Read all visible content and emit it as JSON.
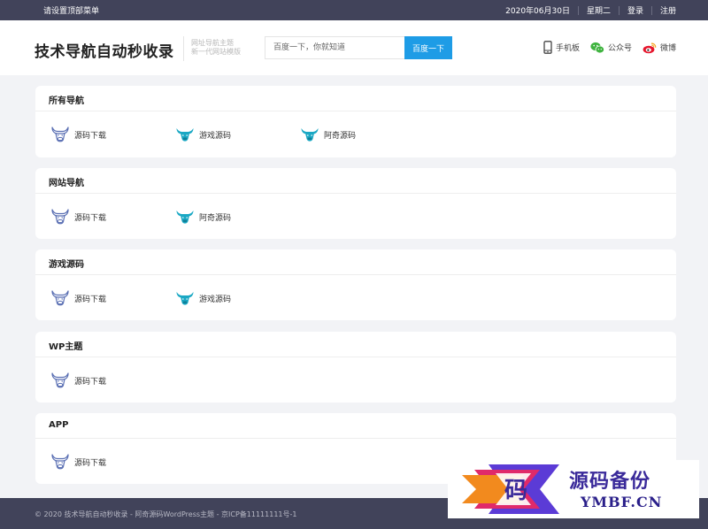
{
  "topbar": {
    "menu_text": "请设置顶部菜单",
    "date": "2020年06月30日",
    "weekday": "星期二",
    "login": "登录",
    "register": "注册"
  },
  "header": {
    "logo": "技术导航自动秒收录",
    "slogan_line1": "网址导航主题",
    "slogan_line2": "新一代网站模版",
    "search_placeholder": "百度一下，你就知道",
    "search_button": "百度一下",
    "links": {
      "mobile": "手机板",
      "wechat": "公众号",
      "weibo": "微博"
    }
  },
  "colors": {
    "accent": "#1e9ce6",
    "dark_bar": "#41435a",
    "bull_outline": "#5a6fb3",
    "bull_filled": "#1aa8c4"
  },
  "sections": [
    {
      "title": "所有导航",
      "sites": [
        {
          "label": "源码下载",
          "icon": "bull-outline-icon"
        },
        {
          "label": "游戏源码",
          "icon": "bull-filled-icon"
        },
        {
          "label": "阿奇源码",
          "icon": "bull-filled-icon"
        }
      ]
    },
    {
      "title": "网站导航",
      "sites": [
        {
          "label": "源码下载",
          "icon": "bull-outline-icon"
        },
        {
          "label": "阿奇源码",
          "icon": "bull-filled-icon"
        }
      ]
    },
    {
      "title": "游戏源码",
      "sites": [
        {
          "label": "源码下载",
          "icon": "bull-outline-icon"
        },
        {
          "label": "游戏源码",
          "icon": "bull-filled-icon"
        }
      ]
    },
    {
      "title": "WP主题",
      "sites": [
        {
          "label": "源码下载",
          "icon": "bull-outline-icon"
        }
      ]
    },
    {
      "title": "APP",
      "sites": [
        {
          "label": "源码下载",
          "icon": "bull-outline-icon"
        }
      ]
    }
  ],
  "footer": {
    "copyright": "© 2020 技术导航自动秒收录 - 阿奇源码WordPress主题 - 京ICP备11111111号-1"
  },
  "watermark": {
    "glyph": "码",
    "title": "源码备份",
    "domain": "YMBF.CN"
  }
}
